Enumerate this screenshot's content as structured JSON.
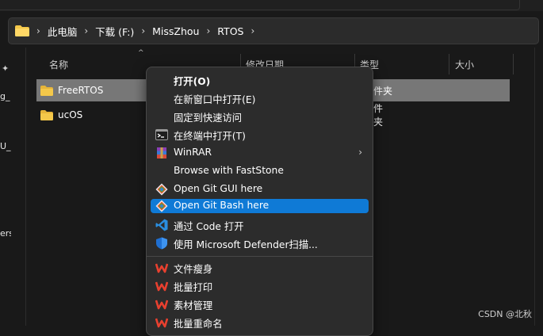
{
  "breadcrumb": [
    "此电脑",
    "下载 (F:)",
    "MissZhou",
    "RTOS"
  ],
  "left_fragments": [
    "g_",
    "U_",
    "ers"
  ],
  "columns": {
    "name": "名称",
    "date": "修改日期",
    "type": "类型",
    "size": "大小"
  },
  "files": [
    {
      "name": "FreeRTOS",
      "type": "件夹",
      "selected": true
    },
    {
      "name": "ucOS",
      "type": "件夹",
      "selected": false
    }
  ],
  "context_menu": {
    "items": [
      {
        "label": "打开(O)",
        "icon": null,
        "bold": true
      },
      {
        "label": "在新窗口中打开(E)",
        "icon": null
      },
      {
        "label": "固定到快速访问",
        "icon": null
      },
      {
        "label": "在终端中打开(T)",
        "icon": "terminal-icon"
      },
      {
        "label": "WinRAR",
        "icon": "winrar-icon",
        "submenu": true
      },
      {
        "label": "Browse with FastStone",
        "icon": null
      },
      {
        "label": "Open Git GUI here",
        "icon": "git-gui-icon"
      },
      {
        "label": "Open Git Bash here",
        "icon": "git-bash-icon",
        "highlighted": true
      },
      {
        "label": "通过 Code 打开",
        "icon": "vscode-icon"
      },
      {
        "label": "使用 Microsoft Defender扫描...",
        "icon": "defender-shield-icon"
      },
      {
        "label": "文件瘦身",
        "icon": "wps-icon"
      },
      {
        "label": "批量打印",
        "icon": "wps-icon"
      },
      {
        "label": "素材管理",
        "icon": "wps-icon"
      },
      {
        "label": "批量重命名",
        "icon": "wps-icon"
      }
    ]
  },
  "watermark": "CSDN @北秋",
  "colors": {
    "highlight": "#0f7ad6",
    "selected_row": "#777777",
    "folder": "#f4c84a",
    "wps": "#e8402f"
  }
}
